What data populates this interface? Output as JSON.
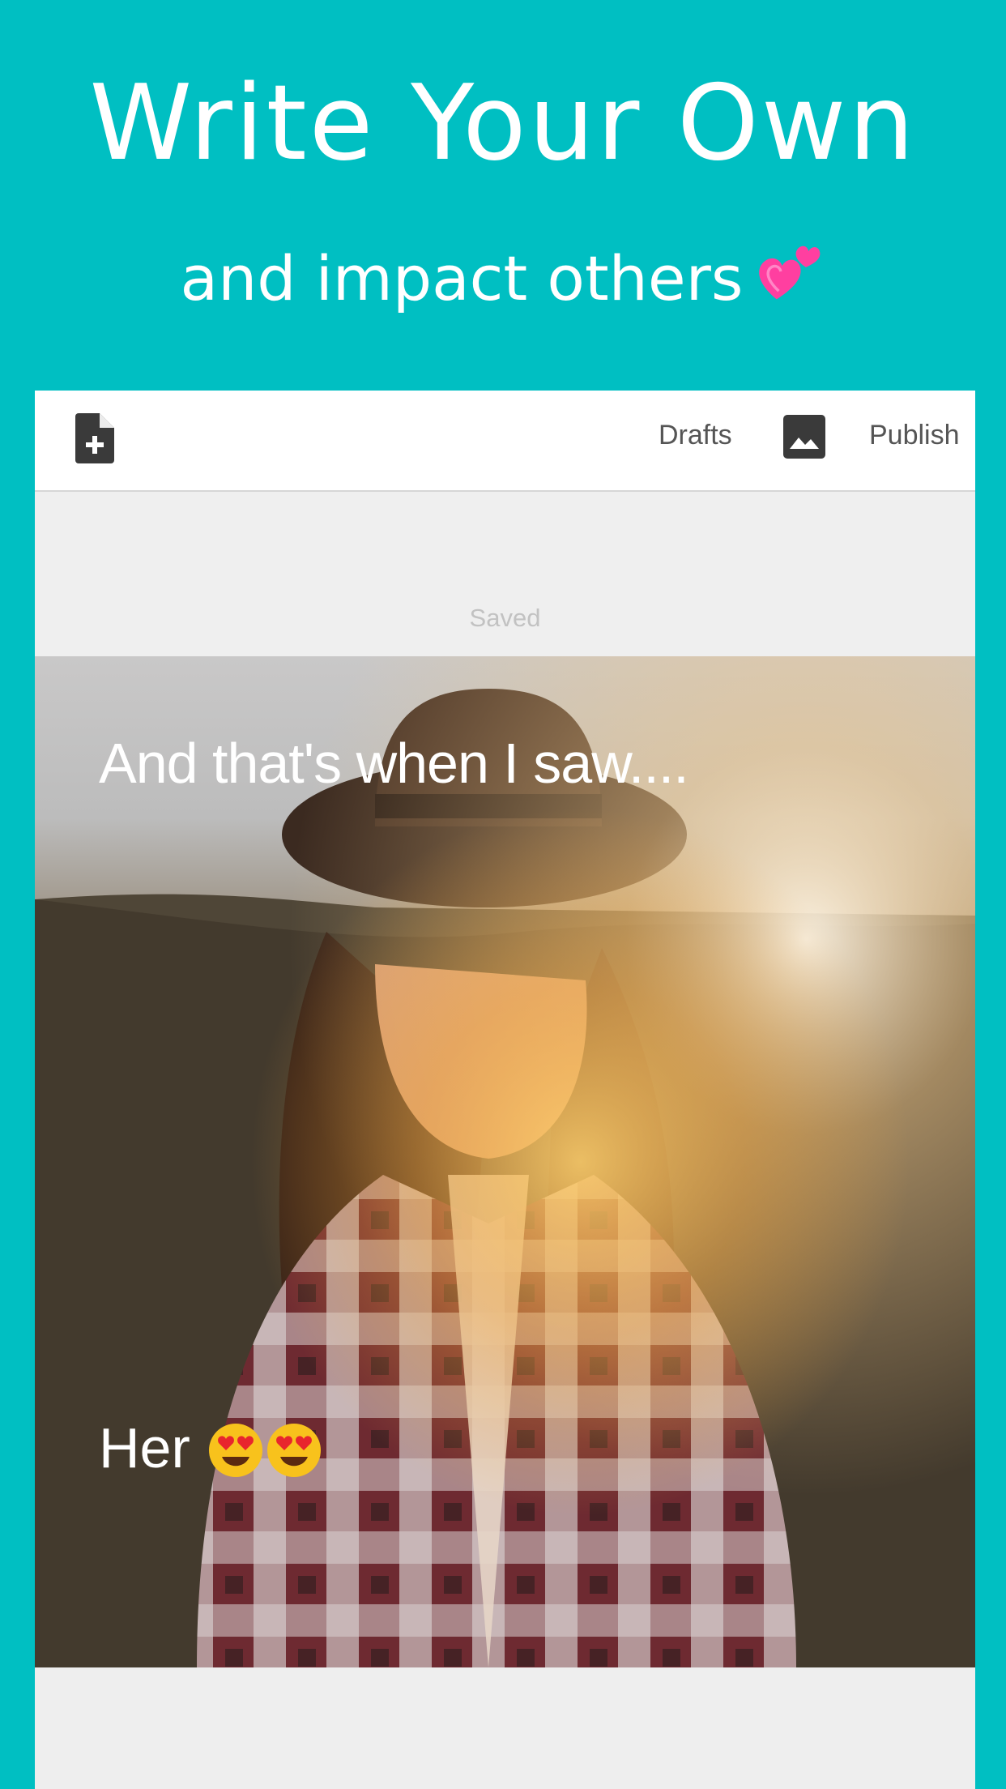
{
  "promo": {
    "title": "Write Your Own",
    "subtitle": "and impact others",
    "subtitle_icon": "two-hearts-icon"
  },
  "colors": {
    "background": "#00bfc2",
    "toolbar_bg": "#ffffff",
    "editor_bg": "#efefef",
    "toolbar_text": "#555555",
    "status_text": "#c2c2c2",
    "accent_pink": "#ff4fa6"
  },
  "toolbar": {
    "new_doc_icon": "new-document-icon",
    "drafts_label": "Drafts",
    "image_icon": "image-icon",
    "publish_label": "Publish"
  },
  "editor": {
    "status": "Saved"
  },
  "story": {
    "top_text": "And that's when I saw....",
    "bottom_text": "Her",
    "bottom_emojis": [
      "heart-eyes-emoji-icon",
      "heart-eyes-emoji-icon"
    ]
  }
}
